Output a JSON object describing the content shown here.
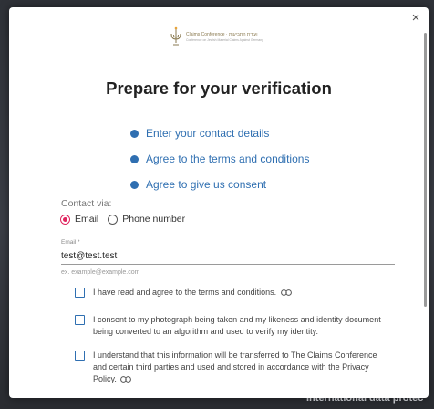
{
  "backdrop": {
    "partial_text": "International data protec"
  },
  "modal": {
    "logo": {
      "line1": "Claims Conference · ועידת התביעות",
      "line2": "Conference on Jewish Material Claims Against Germany"
    },
    "title": "Prepare for your verification",
    "steps": [
      {
        "label": "Enter your contact details"
      },
      {
        "label": "Agree to the terms and conditions"
      },
      {
        "label": "Agree to give us consent"
      }
    ],
    "contact": {
      "label": "Contact via:",
      "options": [
        {
          "label": "Email",
          "selected": true
        },
        {
          "label": "Phone number",
          "selected": false
        }
      ]
    },
    "email": {
      "label": "Email *",
      "value": "test@test.test",
      "hint": "ex. example@example.com"
    },
    "consents": [
      {
        "text": "I have read and agree to the terms and conditions.",
        "has_link_icon": true
      },
      {
        "text": "I consent to my photograph being taken and my likeness and identity document being converted to an algorithm and used to verify my identity.",
        "has_link_icon": false
      },
      {
        "text": "I understand that this information will be transferred to The Claims Conference and certain third parties and used and stored in accordance with the Privacy Policy.",
        "has_link_icon": true
      }
    ],
    "close_label": "×"
  },
  "colors": {
    "accent": "#2f6fb1",
    "radio_selected": "#e0245e"
  },
  "icons": {
    "close": "close-icon",
    "link": "link-icon",
    "logo": "menorah-logo-icon"
  }
}
